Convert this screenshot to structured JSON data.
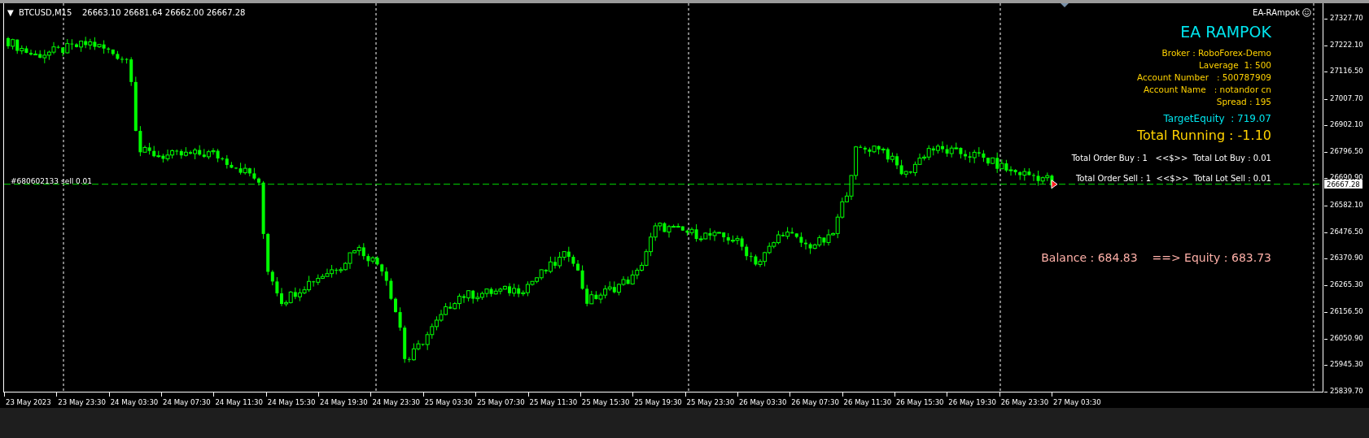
{
  "chart_header": {
    "menu_glyph": "▼",
    "symbol": "BTCUSD,M15",
    "quote": "26663.10 26681.64 26662.00 26667.28"
  },
  "expert": {
    "name": "EA-RAmpok"
  },
  "panel": {
    "title": "EA RAMPOK",
    "info_lines": [
      "Broker : RoboForex-Demo",
      "Laverage  1: 500",
      "Account Number   : 500787909",
      "Account Name   : notandor cn",
      "Spread : 195"
    ],
    "target_equity": "TargetEquity  : 719.07",
    "total_running": "Total Running : -1.10",
    "order_buy": "Total Order Buy : 1   <<$>>  Total Lot Buy : 0.01",
    "order_sell": "Total Order Sell : 1  <<$>>  Total Lot Sell : 0.01",
    "balance": "Balance : 684.83    ==> Equity : 683.73"
  },
  "order_line": {
    "label": "#680602133 sell 0.01"
  },
  "price_axis": {
    "labels": [
      "27327.70",
      "27222.10",
      "27116.50",
      "27007.70",
      "26902.10",
      "26796.50",
      "26690.90",
      "26582.10",
      "26476.50",
      "26370.90",
      "26265.30",
      "26156.50",
      "26050.90",
      "25945.30",
      "25839.70"
    ],
    "current_price": "26667.28"
  },
  "time_axis": {
    "labels": [
      "23 May 2023",
      "23 May 23:30",
      "24 May 03:30",
      "24 May 07:30",
      "24 May 11:30",
      "24 May 15:30",
      "24 May 19:30",
      "24 May 23:30",
      "25 May 03:30",
      "25 May 07:30",
      "25 May 11:30",
      "25 May 15:30",
      "25 May 19:30",
      "25 May 23:30",
      "26 May 03:30",
      "26 May 07:30",
      "26 May 11:30",
      "26 May 15:30",
      "26 May 19:30",
      "26 May 23:30",
      "27 May 03:30"
    ]
  }
}
